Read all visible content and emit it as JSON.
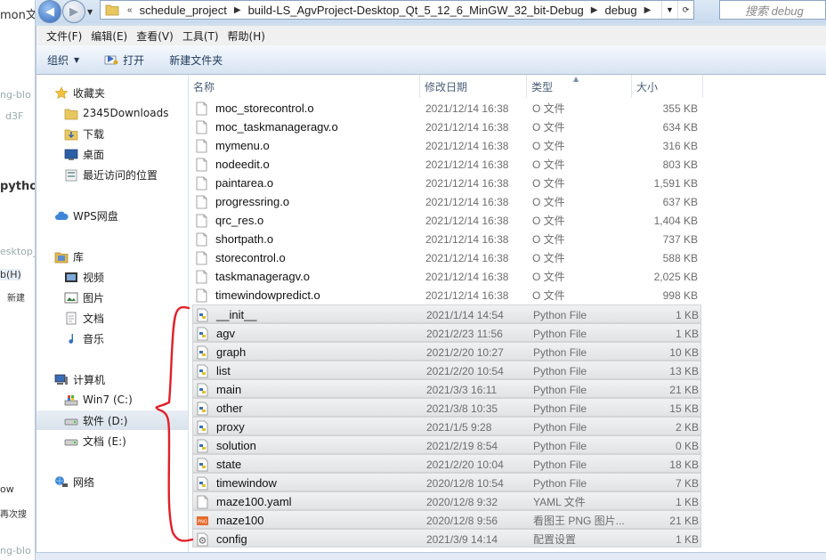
{
  "background_app": {
    "fragments": [
      "mon文",
      "ng-blo",
      "d3F",
      "pytho",
      "esktop_",
      "b(H)",
      "新建",
      "ow",
      "再次搜",
      "ng-blo"
    ]
  },
  "address": {
    "overflow": "«",
    "crumbs": [
      "schedule_project",
      "build-LS_AgvProject-Desktop_Qt_5_12_6_MinGW_32_bit-Debug",
      "debug"
    ],
    "search_placeholder": "搜索 debug"
  },
  "menu": [
    "文件(F)",
    "编辑(E)",
    "查看(V)",
    "工具(T)",
    "帮助(H)"
  ],
  "toolbar": {
    "organize": "组织",
    "open": "打开",
    "new_folder": "新建文件夹"
  },
  "nav": {
    "favorites": "收藏夹",
    "fav_items": [
      "2345Downloads",
      "下载",
      "桌面",
      "最近访问的位置"
    ],
    "wps": "WPS网盘",
    "libraries": "库",
    "lib_items": [
      "视频",
      "图片",
      "文档",
      "音乐"
    ],
    "computer": "计算机",
    "drives": [
      "Win7 (C:)",
      "软件 (D:)",
      "文档 (E:)"
    ],
    "network": "网络"
  },
  "columns": {
    "name": "名称",
    "date": "修改日期",
    "type": "类型",
    "size": "大小"
  },
  "files": [
    {
      "name": "moc_storecontrol.o",
      "date": "2021/12/14 16:38",
      "type": "O 文件",
      "size": "355 KB",
      "icon": "blank-file-icon"
    },
    {
      "name": "moc_taskmanageragv.o",
      "date": "2021/12/14 16:38",
      "type": "O 文件",
      "size": "634 KB",
      "icon": "blank-file-icon"
    },
    {
      "name": "mymenu.o",
      "date": "2021/12/14 16:38",
      "type": "O 文件",
      "size": "316 KB",
      "icon": "blank-file-icon"
    },
    {
      "name": "nodeedit.o",
      "date": "2021/12/14 16:38",
      "type": "O 文件",
      "size": "803 KB",
      "icon": "blank-file-icon"
    },
    {
      "name": "paintarea.o",
      "date": "2021/12/14 16:38",
      "type": "O 文件",
      "size": "1,591 KB",
      "icon": "blank-file-icon"
    },
    {
      "name": "progressring.o",
      "date": "2021/12/14 16:38",
      "type": "O 文件",
      "size": "637 KB",
      "icon": "blank-file-icon"
    },
    {
      "name": "qrc_res.o",
      "date": "2021/12/14 16:38",
      "type": "O 文件",
      "size": "1,404 KB",
      "icon": "blank-file-icon"
    },
    {
      "name": "shortpath.o",
      "date": "2021/12/14 16:38",
      "type": "O 文件",
      "size": "737 KB",
      "icon": "blank-file-icon"
    },
    {
      "name": "storecontrol.o",
      "date": "2021/12/14 16:38",
      "type": "O 文件",
      "size": "588 KB",
      "icon": "blank-file-icon"
    },
    {
      "name": "taskmanageragv.o",
      "date": "2021/12/14 16:38",
      "type": "O 文件",
      "size": "2,025 KB",
      "icon": "blank-file-icon"
    },
    {
      "name": "timewindowpredict.o",
      "date": "2021/12/14 16:38",
      "type": "O 文件",
      "size": "998 KB",
      "icon": "blank-file-icon"
    },
    {
      "name": "__init__",
      "date": "2021/1/14 14:54",
      "type": "Python File",
      "size": "1 KB",
      "icon": "python-file-icon",
      "selected": true
    },
    {
      "name": "agv",
      "date": "2021/2/23 11:56",
      "type": "Python File",
      "size": "1 KB",
      "icon": "python-file-icon",
      "selected": true
    },
    {
      "name": "graph",
      "date": "2021/2/20 10:27",
      "type": "Python File",
      "size": "10 KB",
      "icon": "python-file-icon",
      "selected": true
    },
    {
      "name": "list",
      "date": "2021/2/20 10:54",
      "type": "Python File",
      "size": "13 KB",
      "icon": "python-file-icon",
      "selected": true
    },
    {
      "name": "main",
      "date": "2021/3/3 16:11",
      "type": "Python File",
      "size": "21 KB",
      "icon": "python-file-icon",
      "selected": true
    },
    {
      "name": "other",
      "date": "2021/3/8 10:35",
      "type": "Python File",
      "size": "15 KB",
      "icon": "python-file-icon",
      "selected": true
    },
    {
      "name": "proxy",
      "date": "2021/1/5 9:28",
      "type": "Python File",
      "size": "2 KB",
      "icon": "python-file-icon",
      "selected": true
    },
    {
      "name": "solution",
      "date": "2021/2/19 8:54",
      "type": "Python File",
      "size": "0 KB",
      "icon": "python-file-icon",
      "selected": true
    },
    {
      "name": "state",
      "date": "2021/2/20 10:04",
      "type": "Python File",
      "size": "18 KB",
      "icon": "python-file-icon",
      "selected": true
    },
    {
      "name": "timewindow",
      "date": "2020/12/8 10:54",
      "type": "Python File",
      "size": "7 KB",
      "icon": "python-file-icon",
      "selected": true
    },
    {
      "name": "maze100.yaml",
      "date": "2020/12/8 9:32",
      "type": "YAML 文件",
      "size": "1 KB",
      "icon": "blank-file-icon",
      "selected": true
    },
    {
      "name": "maze100",
      "date": "2020/12/8 9:56",
      "type": "看图王 PNG 图片...",
      "size": "21 KB",
      "icon": "png-file-icon",
      "selected": true
    },
    {
      "name": "config",
      "date": "2021/3/9 14:14",
      "type": "配置设置",
      "size": "1 KB",
      "icon": "config-file-icon",
      "selected": true
    }
  ],
  "colors": {
    "annotation": "#e0202a",
    "selection": "#e4e5e7",
    "window_frame": "#c9daee"
  }
}
